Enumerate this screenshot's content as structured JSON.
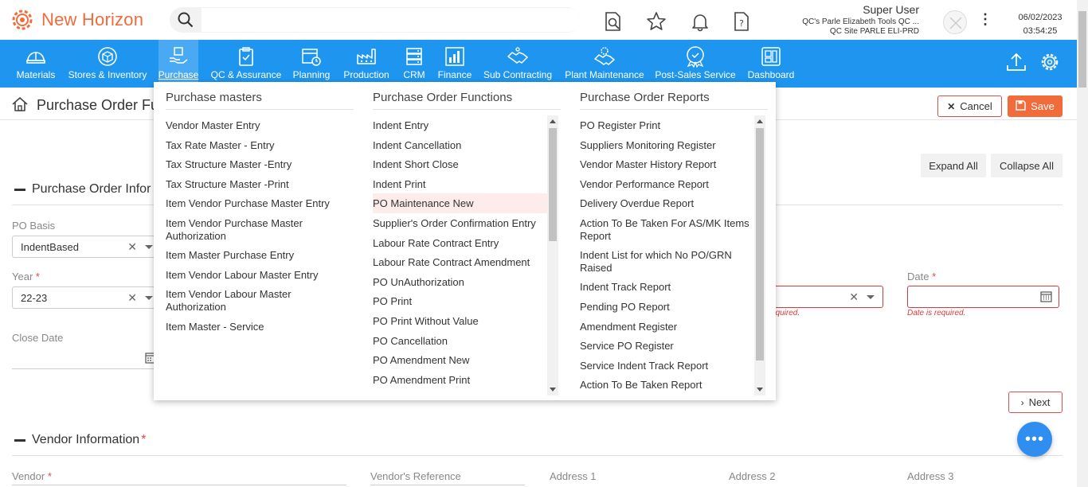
{
  "header": {
    "brand": "New Horizon",
    "search_placeholder": "",
    "user_name": "Super User",
    "user_org": "QC's Parle Elizabeth Tools QC ...",
    "user_site": "QC Site PARLE ELI-PRD",
    "date": "06/02/2023",
    "time": "03:54:25"
  },
  "nav": {
    "items": [
      {
        "label": "Materials",
        "icon": "helmet-icon"
      },
      {
        "label": "Stores & Inventory",
        "icon": "box-icon"
      },
      {
        "label": "Purchase",
        "icon": "hand-box-icon"
      },
      {
        "label": "QC & Assurance",
        "icon": "clipboard-check-icon"
      },
      {
        "label": "Planning",
        "icon": "calendar-clock-icon"
      },
      {
        "label": "Production",
        "icon": "factory-icon"
      },
      {
        "label": "CRM",
        "icon": "server-icon"
      },
      {
        "label": "Finance",
        "icon": "bar-chart-icon"
      },
      {
        "label": "Sub Contracting",
        "icon": "handshake-icon"
      },
      {
        "label": "Plant Maintenance",
        "icon": "handshake-gear-icon"
      },
      {
        "label": "Post-Sales Service",
        "icon": "service-badge-icon"
      },
      {
        "label": "Dashboard",
        "icon": "dashboard-icon"
      }
    ]
  },
  "page": {
    "title": "Purchase Order Fu",
    "cancel": "Cancel",
    "save": "Save",
    "expand_all": "Expand All",
    "collapse_all": "Collapse All",
    "next": "Next",
    "section1": "Purchase Order Infor",
    "section2": "Vendor Information",
    "req_mark": "*",
    "po_basis_label": "PO Basis",
    "po_basis_value": "IndentBased",
    "year_label": "Year",
    "year_value": "22-23",
    "close_date_label": "Close Date",
    "date_label": "Date",
    "date_error": "Date is required.",
    "other_error": "equired.",
    "vendor_label": "Vendor",
    "vendor_ref_label": "Vendor's Reference",
    "address1_label": "Address 1",
    "address2_label": "Address 2",
    "address3_label": "Address 3"
  },
  "mega_menu": {
    "col1": {
      "title": "Purchase masters",
      "items": [
        "Vendor Master Entry",
        "Tax Rate Master - Entry",
        "Tax Structure Master -Entry",
        "Tax Structure Master -Print",
        "Item Vendor Purchase Master Entry",
        "Item Vendor Purchase Master Authorization",
        "Item Master Purchase Entry",
        "Item Vendor Labour Master Entry",
        "Item Vendor Labour Master Authorization",
        "Item Master - Service"
      ]
    },
    "col2": {
      "title": "Purchase Order Functions",
      "items": [
        "Indent Entry",
        "Indent Cancellation",
        "Indent Short Close",
        "Indent Print",
        "PO Maintenance New",
        "Supplier's Order Confirmation Entry",
        "Labour Rate Contract Entry",
        "Labour Rate Contract Amendment",
        "PO UnAuthorization",
        "PO Print",
        "PO Print Without Value",
        "PO Cancellation",
        "PO Amendment New",
        "PO Amendment Print"
      ]
    },
    "col3": {
      "title": "Purchase Order Reports",
      "items": [
        "PO Register Print",
        "Suppliers Monitoring Register",
        "Vendor Master History Report",
        "Vendor Performance Report",
        "Delivery Overdue Report",
        "Action To Be Taken For AS/MK Items Report",
        "Indent List for which No PO/GRN Raised",
        "Indent Track Report",
        "Pending PO Report",
        "Amendment Register",
        "Service PO Register",
        "Service Indent Track Report",
        "Action To Be Taken Report"
      ]
    }
  }
}
